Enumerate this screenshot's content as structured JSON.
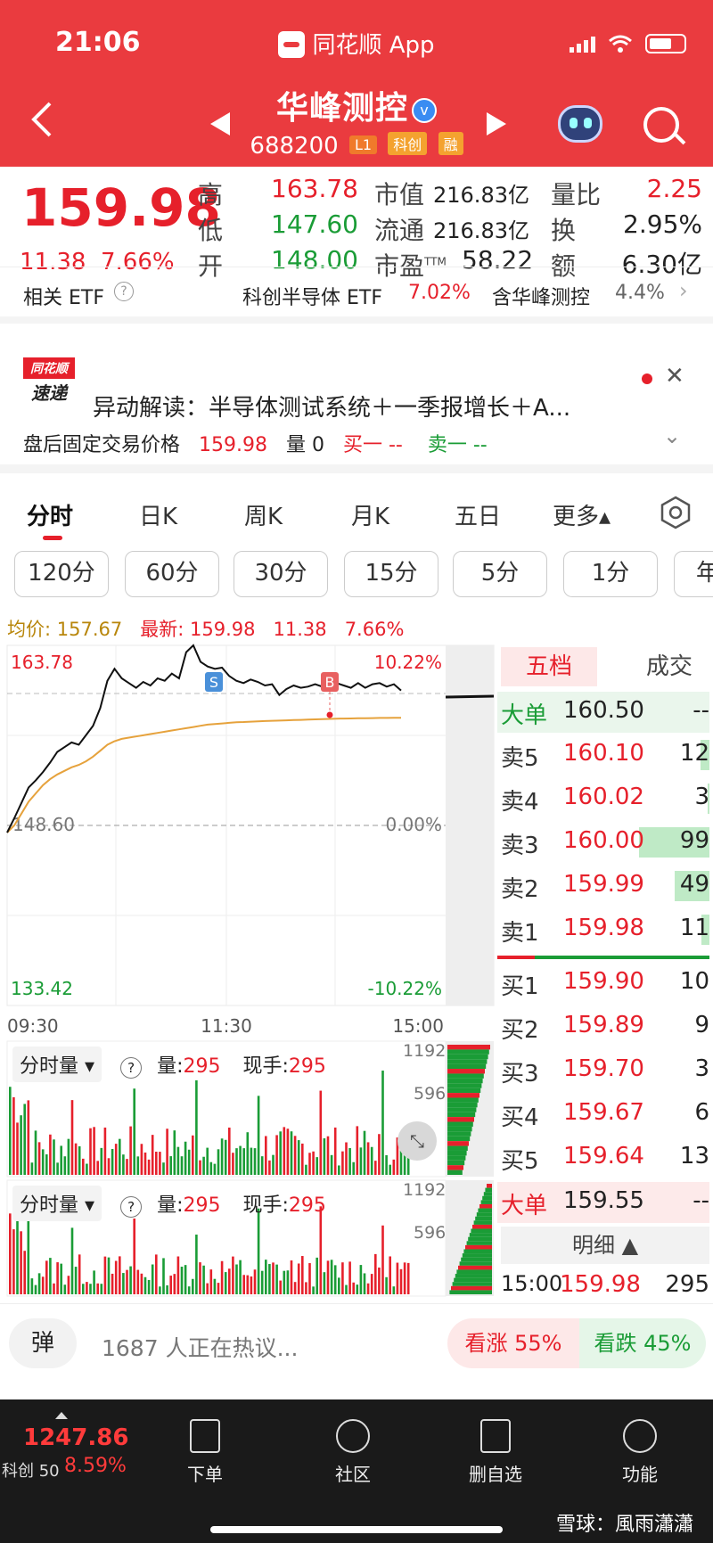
{
  "status_bar": {
    "time": "21:06",
    "app_title": "同花顺 App"
  },
  "header": {
    "stock_name": "华峰测控",
    "verify_mark": "v",
    "stock_code": "688200",
    "tags": [
      "L1",
      "科创",
      "融"
    ]
  },
  "quote": {
    "price": "159.98",
    "change": "11.38",
    "change_pct": "7.66%",
    "high_label": "高",
    "high": "163.78",
    "low_label": "低",
    "low": "147.60",
    "open_label": "开",
    "open": "148.00",
    "mktcap_label": "市值",
    "mktcap": "216.83亿",
    "float_label": "流通",
    "float": "216.83亿",
    "pe_label": "市盈",
    "pe_sup": "TTM",
    "pe": "58.22",
    "vol_ratio_label": "量比",
    "vol_ratio": "2.25",
    "turnover_label": "换",
    "turnover": "2.95%",
    "amount_label": "额",
    "amount": "6.30亿"
  },
  "etf": {
    "label": "相关 ETF",
    "help": "?",
    "etf_name": "科创半导体 ETF",
    "etf_pct": "7.02%",
    "holding_label": "含华峰测控",
    "holding_pct": "4.4%"
  },
  "news": {
    "logo_top": "同花顺",
    "logo_bottom": "速递",
    "headline": "异动解读：半导体测试系统＋一季报增长＋A...",
    "after_hours_label": "盘后固定交易价格",
    "after_hours_price": "159.98",
    "after_hours_vol_label": "量",
    "after_hours_vol": "0",
    "buy1": "买一 --",
    "sell1": "卖一 --"
  },
  "tabs": [
    "分时",
    "日K",
    "周K",
    "月K",
    "五日",
    "更多▴"
  ],
  "intervals": [
    "120分",
    "60分",
    "30分",
    "15分",
    "5分",
    "1分",
    "年"
  ],
  "chart_header": {
    "avg_label": "均价: 157.67",
    "latest_label": "最新: 159.98",
    "change": "11.38",
    "change_pct": "7.66%"
  },
  "chart_data": {
    "type": "line",
    "y_top": "163.78",
    "y_mid": "148.60",
    "y_bottom": "133.42",
    "pct_top": "10.22%",
    "pct_mid": "0.00%",
    "pct_bottom": "-10.22%",
    "x_ticks": [
      "09:30",
      "11:30",
      "15:00"
    ],
    "markers": [
      "S",
      "B"
    ],
    "ylim": [
      133.42,
      163.78
    ],
    "series": [
      {
        "values": [
          148.0,
          149.2,
          150.5,
          151.8,
          152.4,
          153.1,
          153.9,
          154.8,
          155.2,
          155.6,
          155.4,
          156.2,
          157.0,
          158.5,
          160.8,
          161.8,
          161.0,
          160.6,
          160.2,
          160.7,
          160.4,
          161.0,
          160.8,
          161.4,
          161.0,
          163.2,
          163.78,
          162.4,
          162.0,
          161.8,
          161.9,
          161.2,
          160.8,
          160.6,
          160.9,
          160.7,
          160.4,
          160.5,
          159.6,
          160.1,
          160.4,
          160.2,
          160.3,
          160.5,
          160.3,
          160.4,
          160.6,
          160.4,
          160.2,
          160.6,
          160.2,
          160.5,
          160.6,
          160.3,
          160.5,
          159.98
        ]
      },
      {
        "values": [
          148.0,
          148.6,
          149.6,
          150.6,
          151.3,
          152.0,
          152.5,
          152.9,
          153.2,
          153.5,
          153.7,
          154.0,
          154.4,
          154.9,
          155.4,
          155.7,
          155.9,
          156.0,
          156.1,
          156.2,
          156.3,
          156.4,
          156.5,
          156.6,
          156.7,
          156.8,
          156.9,
          157.0,
          157.1,
          157.15,
          157.2,
          157.25,
          157.3,
          157.32,
          157.35,
          157.37,
          157.4,
          157.42,
          157.44,
          157.46,
          157.48,
          157.5,
          157.52,
          157.54,
          157.56,
          157.58,
          157.6,
          157.61,
          157.62,
          157.63,
          157.64,
          157.65,
          157.66,
          157.66,
          157.67,
          157.67
        ]
      }
    ]
  },
  "volume_panel_1": {
    "label": "分时量",
    "vol_label": "量:",
    "vol": "295",
    "hand_label": "现手:",
    "hand": "295",
    "max": "1192",
    "mid": "596"
  },
  "volume_panel_2": {
    "label": "分时量",
    "vol_label": "量:",
    "vol": "295",
    "hand_label": "现手:",
    "hand": "295",
    "max": "1192",
    "mid": "596"
  },
  "order_book": {
    "tab_active": "五档",
    "tab_other": "成交",
    "top_big": {
      "label": "大单",
      "price": "160.50",
      "vol": "--"
    },
    "asks": [
      {
        "label": "卖5",
        "price": "160.10",
        "vol": "12",
        "bar": 0.12
      },
      {
        "label": "卖4",
        "price": "160.02",
        "vol": "3",
        "bar": 0.03
      },
      {
        "label": "卖3",
        "price": "160.00",
        "vol": "99",
        "bar": 0.99
      },
      {
        "label": "卖2",
        "price": "159.99",
        "vol": "49",
        "bar": 0.49
      },
      {
        "label": "卖1",
        "price": "159.98",
        "vol": "11",
        "bar": 0.11
      }
    ],
    "bids": [
      {
        "label": "买1",
        "price": "159.90",
        "vol": "10"
      },
      {
        "label": "买2",
        "price": "159.89",
        "vol": "9"
      },
      {
        "label": "买3",
        "price": "159.70",
        "vol": "3"
      },
      {
        "label": "买4",
        "price": "159.67",
        "vol": "6"
      },
      {
        "label": "买5",
        "price": "159.64",
        "vol": "13"
      }
    ],
    "bottom_big": {
      "label": "大单",
      "price": "159.55",
      "vol": "--"
    },
    "detail_label": "明细 ▲",
    "trade": {
      "time": "15:00",
      "price": "159.98",
      "vol": "295"
    }
  },
  "comment_bar": {
    "danmu": "弹",
    "hot_text": "1687 人正在热议...",
    "up": "看涨 55%",
    "down": "看跌 45%"
  },
  "bottom_nav": {
    "index_value": "1247.86",
    "index_name": "科创 50",
    "index_pct": "8.59%",
    "items": [
      "下单",
      "社区",
      "删自选",
      "功能"
    ],
    "watermark": "雪球：風雨瀟瀟"
  },
  "colors": {
    "brand_red": "#ea3b3f",
    "up": "#e6202b",
    "down": "#1a9c36",
    "avg_line": "#e6a23c"
  }
}
